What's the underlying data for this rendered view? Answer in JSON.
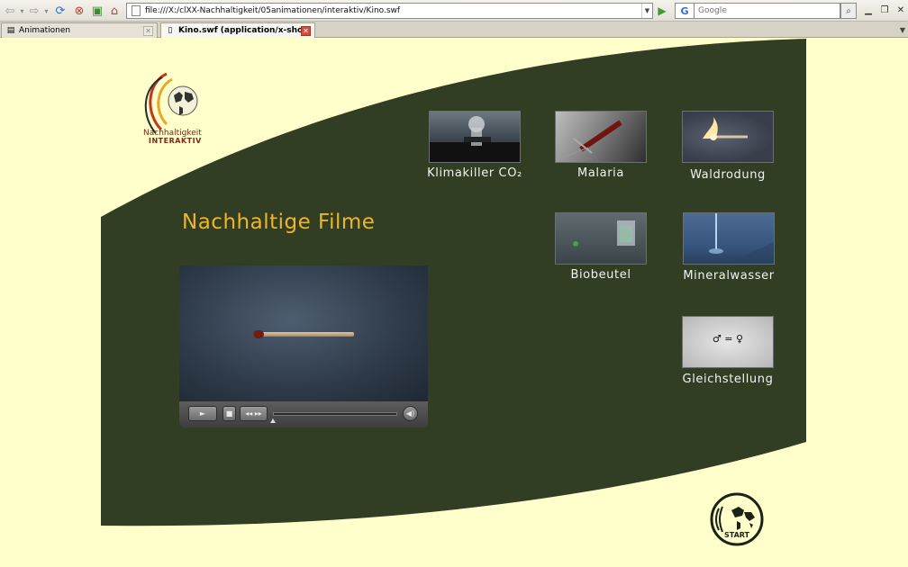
{
  "browser": {
    "url": "file:///X:/clXX-Nachhaltigkeit/05animationen/interaktiv/Kino.swf",
    "search_engine_letter": "G",
    "search_placeholder": "Google",
    "tabs": [
      {
        "label": "Animationen",
        "active": false
      },
      {
        "label": "Kino.swf (application/x-shockwa...",
        "active": true
      }
    ]
  },
  "logo": {
    "line1": "Nachhaltigkeit",
    "line2": "INTERAKTIV"
  },
  "page": {
    "title": "Nachhaltige Filme"
  },
  "films": [
    {
      "label": "Klimakiller CO₂"
    },
    {
      "label": "Malaria"
    },
    {
      "label": "Waldrodung"
    },
    {
      "label": "Biobeutel"
    },
    {
      "label": "Mineralwasser"
    },
    {
      "label": "Gleichstellung",
      "thumb_text": "♂ = ♀"
    }
  ],
  "start": {
    "label": "START"
  },
  "colors": {
    "background": "#ffffcc",
    "panel": "#313e23",
    "title": "#f0b429",
    "label": "#f2f2f2"
  }
}
